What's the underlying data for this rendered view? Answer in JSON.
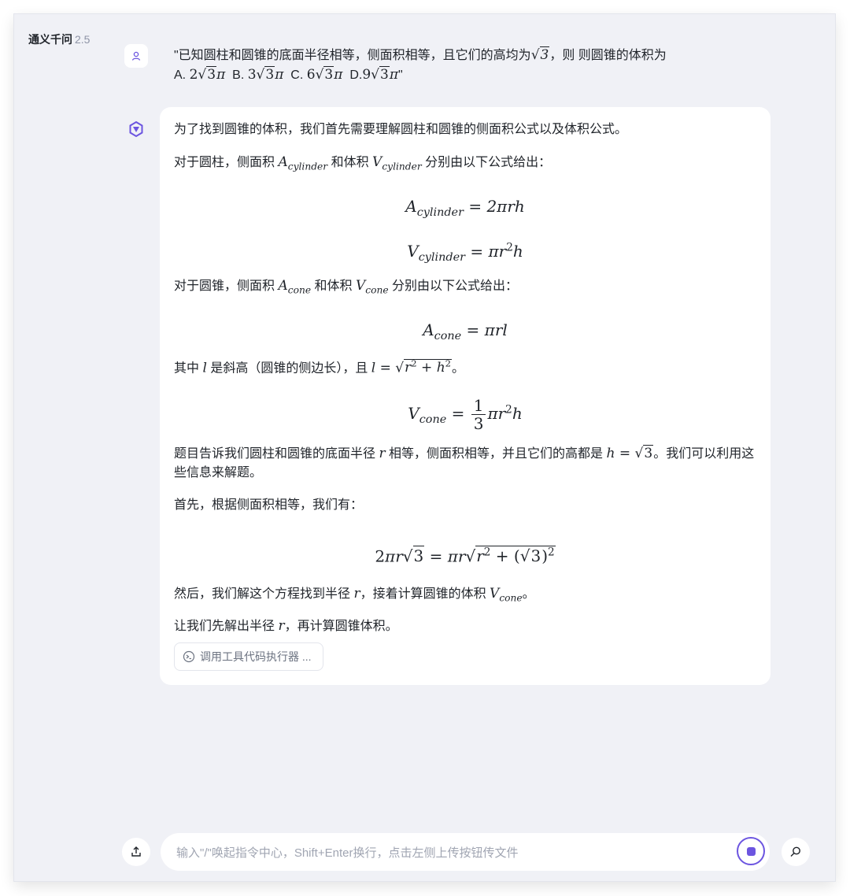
{
  "app": {
    "name": "通义千问",
    "version": "2.5"
  },
  "user_message": {
    "line1_pre": "\"已知圆柱和圆锥的底面半径相等，侧面积相等，且它们的高均为",
    "line1_post": "，则 则圆锥的体积为",
    "opt_a": "A. ",
    "opt_b": "B. ",
    "opt_c": "C. ",
    "opt_d": "D.",
    "close_quote": "\""
  },
  "bot_message": {
    "p1": "为了找到圆锥的体积，我们首先需要理解圆柱和圆锥的侧面积公式以及体积公式。",
    "p2_a": "对于圆柱，侧面积 ",
    "p2_b": " 和体积 ",
    "p2_c": " 分别由以下公式给出：",
    "p3_a": "对于圆锥，侧面积 ",
    "p3_b": " 和体积 ",
    "p3_c": " 分别由以下公式给出：",
    "p4_a": "其中 ",
    "p4_b": " 是斜高（圆锥的侧边长），且 ",
    "p4_c": "。",
    "p5_a": "题目告诉我们圆柱和圆锥的底面半径 ",
    "p5_b": " 相等，侧面积相等，并且它们的高都是 ",
    "p5_c": "。我们可以利用这些信息来解题。",
    "p6": "首先，根据侧面积相等，我们有：",
    "p7_a": "然后，我们解这个方程找到半径 ",
    "p7_b": "，接着计算圆锥的体积 ",
    "p7_c": "。",
    "p8_a": "让我们先解出半径 ",
    "p8_b": "，再计算圆锥体积。",
    "tool_chip": "调用工具代码执行器 ..."
  },
  "math": {
    "A": "A",
    "V": "V",
    "cylinder": "cylinder",
    "cone": "cone",
    "r": "r",
    "l": "l",
    "h": "h",
    "two": "2",
    "three": "3",
    "six": "6",
    "nine": "9",
    "pi": "π",
    "eq": " = ",
    "plus": " + ",
    "one": "1",
    "sqrt": "√",
    "lparen": "(",
    "rparen": ")",
    "two_pi_r_h": "2πrh",
    "pi_r": "πr",
    "pi_r_l": "πrl"
  },
  "input": {
    "placeholder": "输入\"/\"唤起指令中心，Shift+Enter换行，点击左侧上传按钮传文件"
  },
  "colors": {
    "accent": "#6c55e0",
    "window_bg": "#f0f1f6",
    "card_bg": "#ffffff"
  }
}
